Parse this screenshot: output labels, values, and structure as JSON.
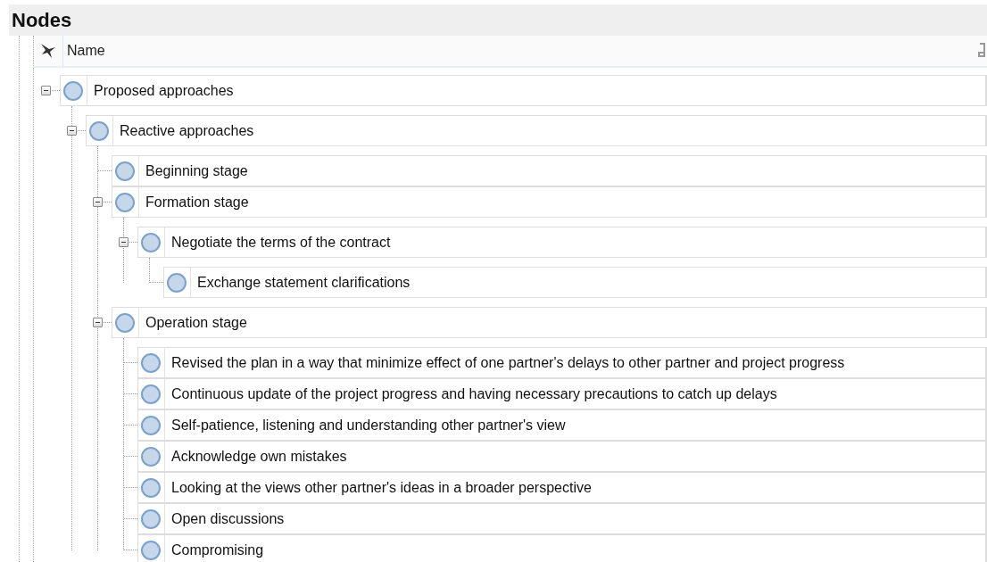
{
  "panel": {
    "title": "Nodes"
  },
  "columns": [
    "Name"
  ],
  "tree": [
    {
      "name": "Proposed approaches",
      "expanded": true,
      "children": [
        {
          "name": "Reactive approaches",
          "expanded": true,
          "children": [
            {
              "name": "Beginning stage"
            },
            {
              "name": "Formation stage",
              "expanded": true,
              "children": [
                {
                  "name": "Negotiate the terms of the contract",
                  "expanded": true,
                  "children": [
                    {
                      "name": "Exchange statement clarifications"
                    }
                  ]
                }
              ]
            },
            {
              "name": "Operation stage",
              "expanded": true,
              "children": [
                {
                  "name": "Revised the plan in a way that minimize effect of one partner's delays to other partner and project progress"
                },
                {
                  "name": "Continuous update of the project progress and having necessary precautions to catch up delays"
                },
                {
                  "name": "Self-patience, listening and understanding other partner's view"
                },
                {
                  "name": "Acknowledge own mistakes"
                },
                {
                  "name": "Looking at the views other partner's ideas in a broader perspective"
                },
                {
                  "name": "Open discussions"
                },
                {
                  "name": "Compromising"
                }
              ]
            }
          ]
        }
      ]
    }
  ]
}
